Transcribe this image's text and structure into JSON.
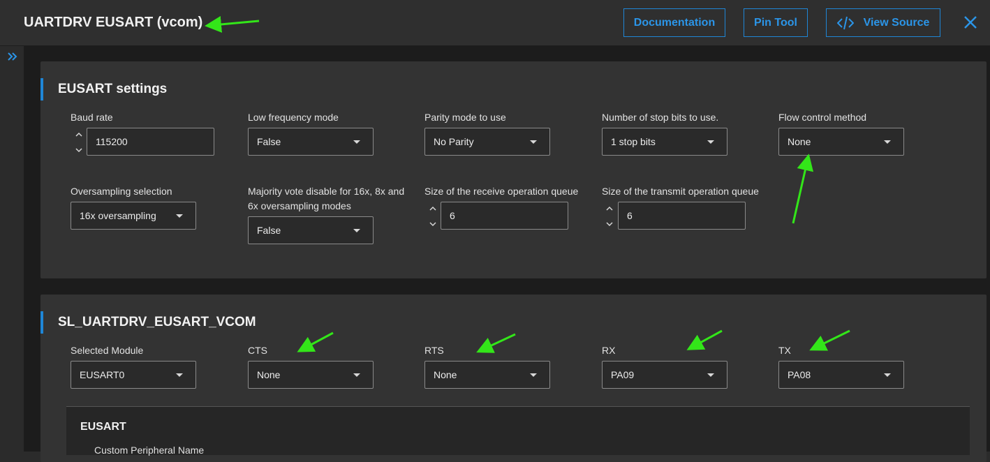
{
  "header": {
    "title": "UARTDRV EUSART (vcom)",
    "buttons": {
      "documentation": "Documentation",
      "pin_tool": "Pin Tool",
      "view_source": "View Source"
    },
    "close_icon": "close-icon",
    "accent": "#1f86d6"
  },
  "sidebar": {
    "toggle_icon": "double-chevron-right-icon"
  },
  "eusart_settings": {
    "title": "EUSART settings",
    "baud_rate": {
      "label": "Baud rate",
      "value": "115200"
    },
    "low_frequency_mode": {
      "label": "Low frequency mode",
      "value": "False"
    },
    "parity_mode": {
      "label": "Parity mode to use",
      "value": "No Parity"
    },
    "stop_bits": {
      "label": "Number of stop bits to use.",
      "value": "1 stop bits"
    },
    "flow_control": {
      "label": "Flow control method",
      "value": "None"
    },
    "oversampling": {
      "label": "Oversampling selection",
      "value": "16x oversampling"
    },
    "majority_vote": {
      "label_line1": "Majority vote disable for 16x, 8x and",
      "label_line2": "6x oversampling modes",
      "value": "False"
    },
    "rx_queue": {
      "label": "Size of the receive operation queue",
      "value": "6"
    },
    "tx_queue": {
      "label": "Size of the transmit operation queue",
      "value": "6"
    }
  },
  "vcom": {
    "title": "SL_UARTDRV_EUSART_VCOM",
    "selected_module": {
      "label": "Selected Module",
      "value": "EUSART0"
    },
    "cts": {
      "label": "CTS",
      "value": "None"
    },
    "rts": {
      "label": "RTS",
      "value": "None"
    },
    "rx": {
      "label": "RX",
      "value": "PA09"
    },
    "tx": {
      "label": "TX",
      "value": "PA08"
    }
  },
  "eusart_subpanel": {
    "title": "EUSART",
    "custom_name_label": "Custom Peripheral Name"
  },
  "annotation_color": "#33e619"
}
